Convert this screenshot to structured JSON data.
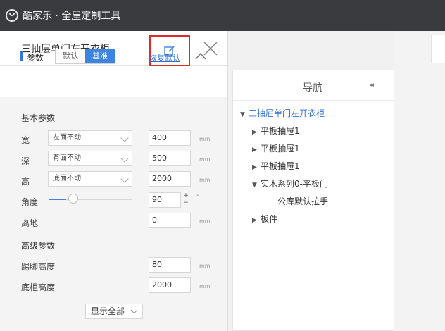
{
  "app": {
    "title": "酷家乐 · 全屋定制工具"
  },
  "panel": {
    "title": "三抽层单门左开衣柜",
    "params_label": "参数",
    "tabs": [
      {
        "label": "默认",
        "active": false
      },
      {
        "label": "基准",
        "active": true
      }
    ],
    "restore_label": "恢复默认",
    "basic_section": "基本参数",
    "rows": {
      "width": {
        "label": "宽",
        "select": "左面不动",
        "value": "400",
        "unit": "mm"
      },
      "depth": {
        "label": "深",
        "select": "背面不动",
        "value": "500",
        "unit": "mm"
      },
      "height": {
        "label": "高",
        "select": "底面不动",
        "value": "2000",
        "unit": "mm"
      },
      "angle": {
        "label": "角度",
        "value": "90",
        "unit": "°",
        "slider": 0.2,
        "stepper_up": "+",
        "stepper_down": "−"
      },
      "ground": {
        "label": "离地",
        "value": "0",
        "unit": "mm"
      }
    },
    "advanced_section": "高级参数",
    "adv_rows": {
      "kick": {
        "label": "踢脚高度",
        "value": "80",
        "unit": "mm"
      },
      "cabinet": {
        "label": "底柜高度",
        "value": "2000",
        "unit": "mm"
      }
    },
    "show_all_label": "显示全部"
  },
  "nav": {
    "title": "导航",
    "collapse_glyph": "◂◂",
    "tree": [
      {
        "label": "三抽屉单门左开衣柜",
        "arrow": "▼"
      },
      {
        "label": "平板抽屉1",
        "arrow": "▶"
      },
      {
        "label": "平板抽屉1",
        "arrow": "▶"
      },
      {
        "label": "平板抽屉1",
        "arrow": "▶"
      },
      {
        "label": "实木系列0-平板门",
        "arrow": "▼"
      },
      {
        "label": "公库默认拉手",
        "arrow": ""
      },
      {
        "label": "板件",
        "arrow": "▶"
      }
    ]
  },
  "colors": {
    "accent": "#3d83e0",
    "highlight": "#e02a2a",
    "topbar": "#3a3b3e"
  }
}
